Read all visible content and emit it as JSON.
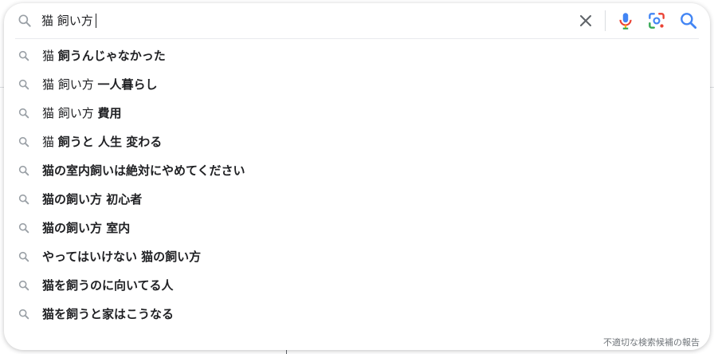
{
  "search": {
    "query": "猫 飼い方",
    "clear_icon": "close-icon",
    "mic_icon": "microphone-icon",
    "lens_icon": "camera-lens-icon",
    "search_icon": "search-icon"
  },
  "suggestions": [
    {
      "base": "猫 ",
      "bold": "飼うんじゃなかった"
    },
    {
      "base": "猫 飼い方 ",
      "bold": "一人暮らし"
    },
    {
      "base": "猫 飼い方 ",
      "bold": "費用"
    },
    {
      "base": "猫 ",
      "bold": "飼うと 人生 変わる"
    },
    {
      "base": "",
      "bold": "猫の室内飼いは絶対にやめてください"
    },
    {
      "base": "",
      "bold": "猫の飼い方 初心者"
    },
    {
      "base": "",
      "bold": "猫の飼い方 室内"
    },
    {
      "base": "",
      "bold": "やってはいけない 猫の飼い方"
    },
    {
      "base": "",
      "bold": "猫を飼うのに向いてる人"
    },
    {
      "base": "",
      "bold": "猫を飼うと家はこうなる"
    }
  ],
  "footer": {
    "report_label": "不適切な検索候補の報告"
  },
  "colors": {
    "text": "#202124",
    "icon_gray": "#5f6368",
    "google_blue": "#4285f4",
    "google_red": "#ea4335",
    "google_yellow": "#fbbc04",
    "google_green": "#34a853"
  }
}
